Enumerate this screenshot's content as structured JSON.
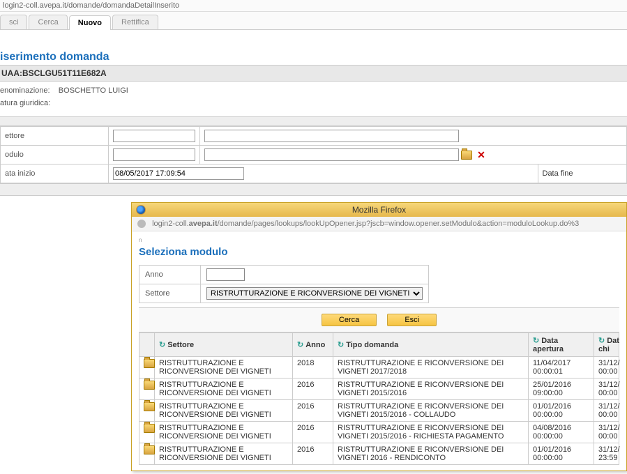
{
  "breadcrumb": "login2-coll.avepa.it/domande/domandaDetailInserito",
  "tabs": [
    "sci",
    "Cerca",
    "Nuovo",
    "Rettifica"
  ],
  "active_tab": 2,
  "page_title": "iserimento domanda",
  "cuaa_line": "UAA:BSCLGU51T11E682A",
  "denom_label": "enominazione:",
  "denom_value": "BOSCHETTO LUIGI",
  "natura_label": "atura giuridica:",
  "form": {
    "settore_label": "ettore",
    "modulo_label": "odulo",
    "datainizio_label": "ata inizio",
    "datainizio_value": "08/05/2017 17:09:54",
    "datafine_label": "Data fine"
  },
  "popup": {
    "title": "Mozilla Firefox",
    "url_prefix": "login2-coll.",
    "url_bold": "avepa.it",
    "url_rest": "/domande/pages/lookups/lookUpOpener.jsp?jscb=window.opener.setModulo&action=moduloLookup.do%3",
    "heading": "Seleziona modulo",
    "anno_label": "Anno",
    "settore_label": "Settore",
    "settore_value": "RISTRUTTURAZIONE E RICONVERSIONE DEI VIGNETI",
    "btn_cerca": "Cerca",
    "btn_esci": "Esci",
    "cols": {
      "settore": "Settore",
      "anno": "Anno",
      "tipodom": "Tipo domanda",
      "datap": "Data apertura",
      "datac": "Dat chi"
    },
    "rows": [
      {
        "settore": "RISTRUTTURAZIONE E RICONVERSIONE DEI VIGNETI",
        "anno": "2018",
        "tipo": "RISTRUTTURAZIONE E RICONVERSIONE DEI VIGNETI 2017/2018",
        "dataap": "11/04/2017 00:00:01",
        "datach": "31/12/ 00:00"
      },
      {
        "settore": "RISTRUTTURAZIONE E RICONVERSIONE DEI VIGNETI",
        "anno": "2016",
        "tipo": "RISTRUTTURAZIONE E RICONVERSIONE DEI VIGNETI 2015/2016",
        "dataap": "25/01/2016 09:00:00",
        "datach": "31/12/ 00:00"
      },
      {
        "settore": "RISTRUTTURAZIONE E RICONVERSIONE DEI VIGNETI",
        "anno": "2016",
        "tipo": "RISTRUTTURAZIONE E RICONVERSIONE DEI VIGNETI 2015/2016 - COLLAUDO",
        "dataap": "01/01/2016 00:00:00",
        "datach": "31/12/ 00:00"
      },
      {
        "settore": "RISTRUTTURAZIONE E RICONVERSIONE DEI VIGNETI",
        "anno": "2016",
        "tipo": "RISTRUTTURAZIONE E RICONVERSIONE DEI VIGNETI 2015/2016 - RICHIESTA PAGAMENTO",
        "dataap": "04/08/2016 00:00:00",
        "datach": "31/12/ 00:00"
      },
      {
        "settore": "RISTRUTTURAZIONE E RICONVERSIONE DEI VIGNETI",
        "anno": "2016",
        "tipo": "RISTRUTTURAZIONE E RICONVERSIONE DEI VIGNETI 2016 - RENDICONTO",
        "dataap": "01/01/2016 00:00:00",
        "datach": "31/12/ 23:59"
      }
    ]
  }
}
